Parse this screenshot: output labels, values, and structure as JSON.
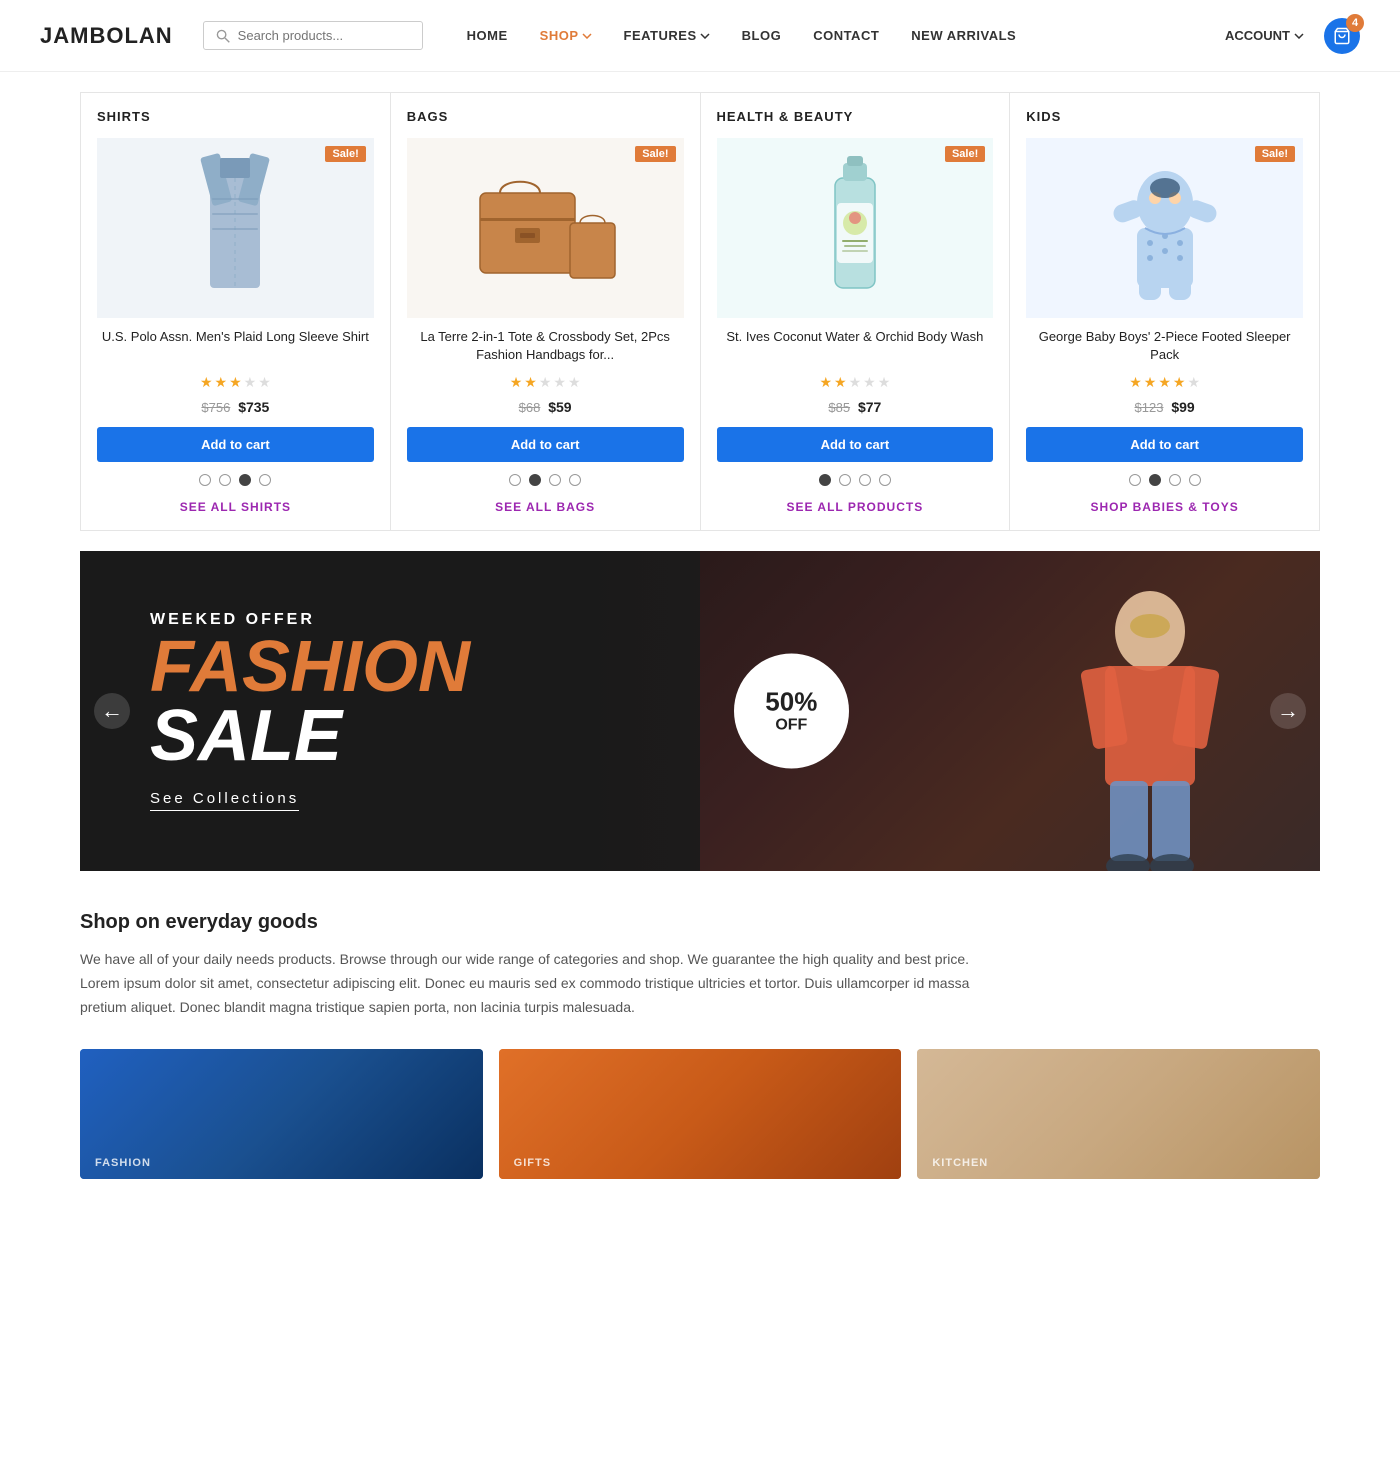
{
  "header": {
    "logo": "JAMBOLAN",
    "search_placeholder": "Search products...",
    "nav_items": [
      {
        "label": "HOME",
        "active": false
      },
      {
        "label": "SHOP",
        "active": true,
        "has_dropdown": true
      },
      {
        "label": "FEATURES",
        "active": false,
        "has_dropdown": true
      },
      {
        "label": "BLOG",
        "active": false
      },
      {
        "label": "CONTACT",
        "active": false
      },
      {
        "label": "NEW ARRIVALS",
        "active": false
      }
    ],
    "account_label": "ACCOUNT",
    "cart_count": "4"
  },
  "product_columns": [
    {
      "id": "shirts",
      "title": "SHIRTS",
      "sale_badge": "Sale!",
      "product_name": "U.S. Polo Assn. Men's Plaid Long Sleeve Shirt",
      "stars_filled": 3,
      "stars_total": 5,
      "old_price": "$756",
      "new_price": "$735",
      "add_to_cart": "Add to cart",
      "active_dot": 2,
      "see_all_label": "SEE ALL SHIRTS",
      "dots": 4
    },
    {
      "id": "bags",
      "title": "BAGS",
      "sale_badge": "Sale!",
      "product_name": "La Terre 2-in-1 Tote & Crossbody Set, 2Pcs Fashion Handbags for...",
      "stars_filled": 2,
      "stars_total": 5,
      "old_price": "$68",
      "new_price": "$59",
      "add_to_cart": "Add to cart",
      "active_dot": 1,
      "see_all_label": "SEE ALL BAGS",
      "dots": 4
    },
    {
      "id": "health-beauty",
      "title": "HEALTH & BEAUTY",
      "sale_badge": "Sale!",
      "product_name": "St. Ives Coconut Water & Orchid Body Wash",
      "stars_filled": 2,
      "stars_total": 5,
      "old_price": "$85",
      "new_price": "$77",
      "add_to_cart": "Add to cart",
      "active_dot": 0,
      "see_all_label": "SEE ALL PRODUCTS",
      "dots": 4
    },
    {
      "id": "kids",
      "title": "KIDS",
      "sale_badge": "Sale!",
      "product_name": "George Baby Boys' 2-Piece Footed Sleeper Pack",
      "stars_filled": 4,
      "stars_total": 5,
      "old_price": "$123",
      "new_price": "$99",
      "add_to_cart": "Add to cart",
      "active_dot": 1,
      "see_all_label": "SHOP BABIES & TOYS",
      "dots": 4
    }
  ],
  "banner": {
    "subtitle": "WEEKED OFFER",
    "title_fashion": "FASHION",
    "title_sale": "SALE",
    "percent": "50%",
    "off": "OFF",
    "see_collections": "See Collections",
    "nav_left": "←",
    "nav_right": "→"
  },
  "shop_section": {
    "title": "Shop on everyday goods",
    "description": "We have all of your daily needs products. Browse through our wide range of categories and shop. We guarantee the high quality and best price. Lorem ipsum dolor sit amet, consectetur adipiscing elit. Donec eu mauris sed ex commodo tristique ultricies et tortor. Duis ullamcorper id massa pretium aliquet. Donec blandit magna tristique sapien porta, non lacinia turpis malesuada."
  },
  "bottom_images": [
    {
      "label": "FASHION",
      "type": "blue"
    },
    {
      "label": "GIFTS",
      "type": "orange"
    },
    {
      "label": "KITCHEN",
      "type": "beige"
    }
  ]
}
